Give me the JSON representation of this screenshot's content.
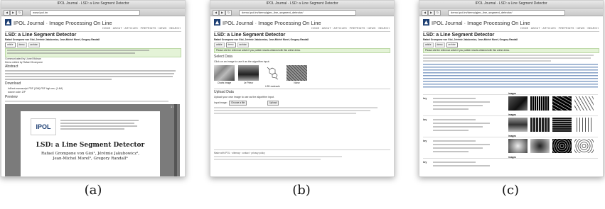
{
  "browser": {
    "window_titles": [
      "IPOL Journal · LSD: a Line Segment Detector",
      "IPOL Journal · LSD: a Line Segment Detector",
      "IPOL Journal · LSD: a Line Segment Detector"
    ],
    "urls": [
      "www.ipol.im",
      "demo.ipol.im/demo/gjmr_line_segment_detector/",
      "demo.ipol.im/demo/gjmr_line_segment_detector/"
    ]
  },
  "site": {
    "name": "IPOL Journal · Image Processing On Line",
    "nav": "HOME · ABOUT · ARTICLES · PREPRINTS · NEWS · SEARCH"
  },
  "article": {
    "title": "LSD: a Line Segment Detector",
    "authors": "Rafael Grompone von Gioi, Jérémie Jakubowicz, Jean-Michel Morel, Gregory Randall",
    "tabs": [
      "article",
      "demo",
      "archive"
    ],
    "communicated": "Communicated by Lionel Moisan",
    "edited": "Demo edited by Rafael Grompone",
    "abstract_heading": "Abstract",
    "download_heading": "Download",
    "download_items": [
      "full text manuscript: PDF (10M) PDF high-res. (1.4M)",
      "source code: ZIP"
    ],
    "preview_heading": "Preview",
    "pdf_logo": "IPOL",
    "pdf_title": "LSD: a Line Segment Detector",
    "pdf_authors_1": "Rafael Grompone von Gioi¹, Jérémie Jakubowicz²,",
    "pdf_authors_2": "Jean-Michel Morel³, Gregory Randall⁴",
    "pdf_page": "1 / 16"
  },
  "demo": {
    "tabs": [
      "article",
      "demo",
      "archive"
    ],
    "notice": "Please cite the reference article if you publish results obtained with this online demo.",
    "select_heading": "Select Data",
    "select_hint": "Click on an image to use it as the algorithm input.",
    "thumbs": [
      "Chairs image",
      "Le Prieur",
      "LSD molecule",
      "Noise"
    ],
    "upload_heading": "Upload Data",
    "upload_hint": "Upload your own image to use as the algorithm input.",
    "input_label": "Input image:",
    "choose_btn": "Choose a file",
    "upload_btn": "Upload",
    "footer": "Made with IPOL · sitemap · contact · privacy policy"
  },
  "archive": {
    "tabs": [
      "article",
      "demo",
      "archive"
    ],
    "notice": "Please cite the reference article if you publish results obtained with this online demo.",
    "entries": [
      {
        "key": "key",
        "images_label": "images"
      },
      {
        "key": "key",
        "images_label": "images"
      },
      {
        "key": "key",
        "images_label": "images"
      },
      {
        "key": "key",
        "images_label": "images"
      }
    ]
  },
  "captions": [
    "(a)",
    "(b)",
    "(c)"
  ]
}
